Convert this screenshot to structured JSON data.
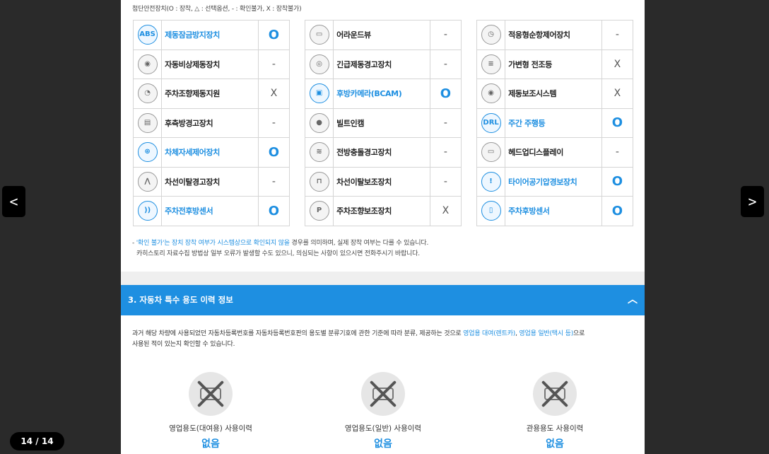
{
  "legend": "첨단안전장치(O : 장착, △ : 선택옵션, - : 확인불가, X : 장착불가)",
  "tables": [
    {
      "rows": [
        {
          "icon": "abs-icon",
          "glyph": "ABS",
          "name": "제동잠금방지장치",
          "value": "O",
          "on": true
        },
        {
          "icon": "emergency-brake-icon",
          "glyph": "◉",
          "name": "자동비상제동장치",
          "value": "-",
          "on": false
        },
        {
          "icon": "parking-steer-icon",
          "glyph": "◔",
          "name": "주차조향제동지원",
          "value": "X",
          "on": false
        },
        {
          "icon": "rear-side-warning-icon",
          "glyph": "▤",
          "name": "후측방경고장치",
          "value": "-",
          "on": false
        },
        {
          "icon": "stability-control-icon",
          "glyph": "⊛",
          "name": "차체자세제어장치",
          "value": "O",
          "on": true
        },
        {
          "icon": "lane-departure-warning-icon",
          "glyph": "⋀",
          "name": "차선이탈경고장치",
          "value": "-",
          "on": false
        },
        {
          "icon": "parking-sensor-icon",
          "glyph": "))",
          "name": "주차전후방센서",
          "value": "O",
          "on": true
        }
      ]
    },
    {
      "rows": [
        {
          "icon": "around-view-icon",
          "glyph": "▭",
          "name": "어라운드뷰",
          "value": "-",
          "on": false
        },
        {
          "icon": "emergency-brake-warning-icon",
          "glyph": "◎",
          "name": "긴급제동경고장치",
          "value": "-",
          "on": false
        },
        {
          "icon": "rear-camera-icon",
          "glyph": "▣",
          "name": "후방카메라(BCAM)",
          "value": "O",
          "on": true
        },
        {
          "icon": "built-in-cam-icon",
          "glyph": "●",
          "name": "빌트인캠",
          "value": "-",
          "on": false
        },
        {
          "icon": "forward-collision-icon",
          "glyph": "≋",
          "name": "전방충돌경고장치",
          "value": "-",
          "on": false
        },
        {
          "icon": "lane-keeping-icon",
          "glyph": "⊓",
          "name": "차선이탈보조장치",
          "value": "-",
          "on": false
        },
        {
          "icon": "parking-assist-icon",
          "glyph": "P",
          "name": "주차조향보조장치",
          "value": "X",
          "on": false
        }
      ]
    },
    {
      "rows": [
        {
          "icon": "adaptive-cruise-icon",
          "glyph": "◷",
          "name": "적응형순항제어장치",
          "value": "-",
          "on": false
        },
        {
          "icon": "adaptive-headlamp-icon",
          "glyph": "≡",
          "name": "가변형 전조등",
          "value": "X",
          "on": false
        },
        {
          "icon": "brake-assist-icon",
          "glyph": "◉",
          "name": "제동보조시스템",
          "value": "X",
          "on": false
        },
        {
          "icon": "daytime-running-light-icon",
          "glyph": "DRL",
          "name": "주간 주행등",
          "value": "O",
          "on": true
        },
        {
          "icon": "head-up-display-icon",
          "glyph": "▭",
          "name": "헤드업디스플레이",
          "value": "-",
          "on": false
        },
        {
          "icon": "tire-pressure-icon",
          "glyph": "!",
          "name": "타이어공기압경보장치",
          "value": "O",
          "on": true
        },
        {
          "icon": "rear-parking-sensor-icon",
          "glyph": "▯",
          "name": "주차후방센서",
          "value": "O",
          "on": true
        }
      ]
    }
  ],
  "notes": {
    "line1_prefix": "- ",
    "line1_em": "'확인 불가'는 장치 장착 여부가 시스템상으로 확인되지 않을",
    "line1_rest": " 경우를 의미하며, 실제 장착 여부는 다를 수 있습니다.",
    "line2": "카히스토리 자료수집 방법상 일부 오류가 발생할 수도 있으니, 의심되는 사항이 있으시면 전화주시기 바랍니다."
  },
  "section": {
    "title": "3. 자동차 특수 용도 이력 정보",
    "chevron": "︿"
  },
  "description": {
    "part1": "과거 해당 차량에 사용되었던 자동차등록번호를 자동차등록번호판의 용도별 분류기호에 관한 기준에 따라 분류, 제공하는 것으로 ",
    "em1": "영업용 대여(렌트카)",
    "part2": ", ",
    "em2": "영업용 일반(택시 등)",
    "part3": "으로",
    "line2": "사용된 적이 있는지 확인할 수 있습니다."
  },
  "usages": [
    {
      "icon": "rental-car-crossed-icon",
      "label": "영업용도(대여용) 사용이력",
      "value": "없음"
    },
    {
      "icon": "taxi-crossed-icon",
      "label": "영업용도(일반) 사용이력",
      "value": "없음"
    },
    {
      "icon": "government-car-crossed-icon",
      "label": "관용용도 사용이력",
      "value": "없음"
    }
  ],
  "viewer": {
    "prev": "<",
    "next": ">",
    "page_counter": "14 / 14"
  }
}
